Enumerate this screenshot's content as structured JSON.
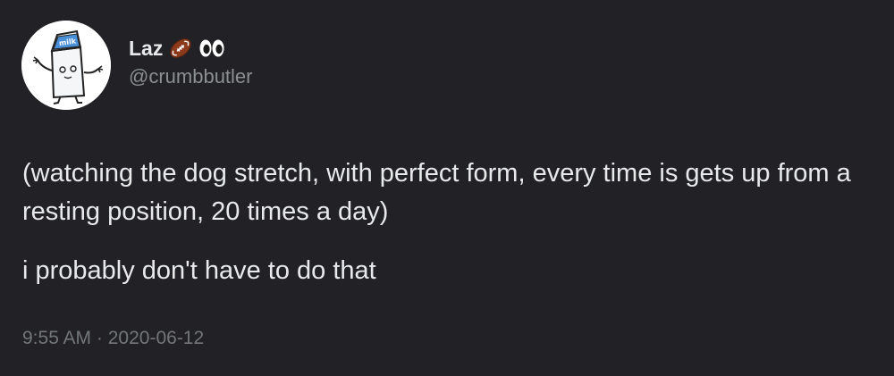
{
  "author": {
    "display_name": "Laz",
    "handle": "@crumbbutler",
    "name_emojis": [
      "football-icon",
      "eyes-icon"
    ],
    "avatar_text": "milk"
  },
  "tweet": {
    "paragraphs": [
      "(watching the dog stretch, with perfect form, every time is gets up from a resting position, 20 times a day)",
      "i probably don't have to do that"
    ],
    "time": "9:55 AM",
    "separator": "·",
    "date": "2020-06-12"
  },
  "colors": {
    "background": "#222226",
    "text_primary": "#e7e9ea",
    "text_secondary": "#8b8f94"
  }
}
